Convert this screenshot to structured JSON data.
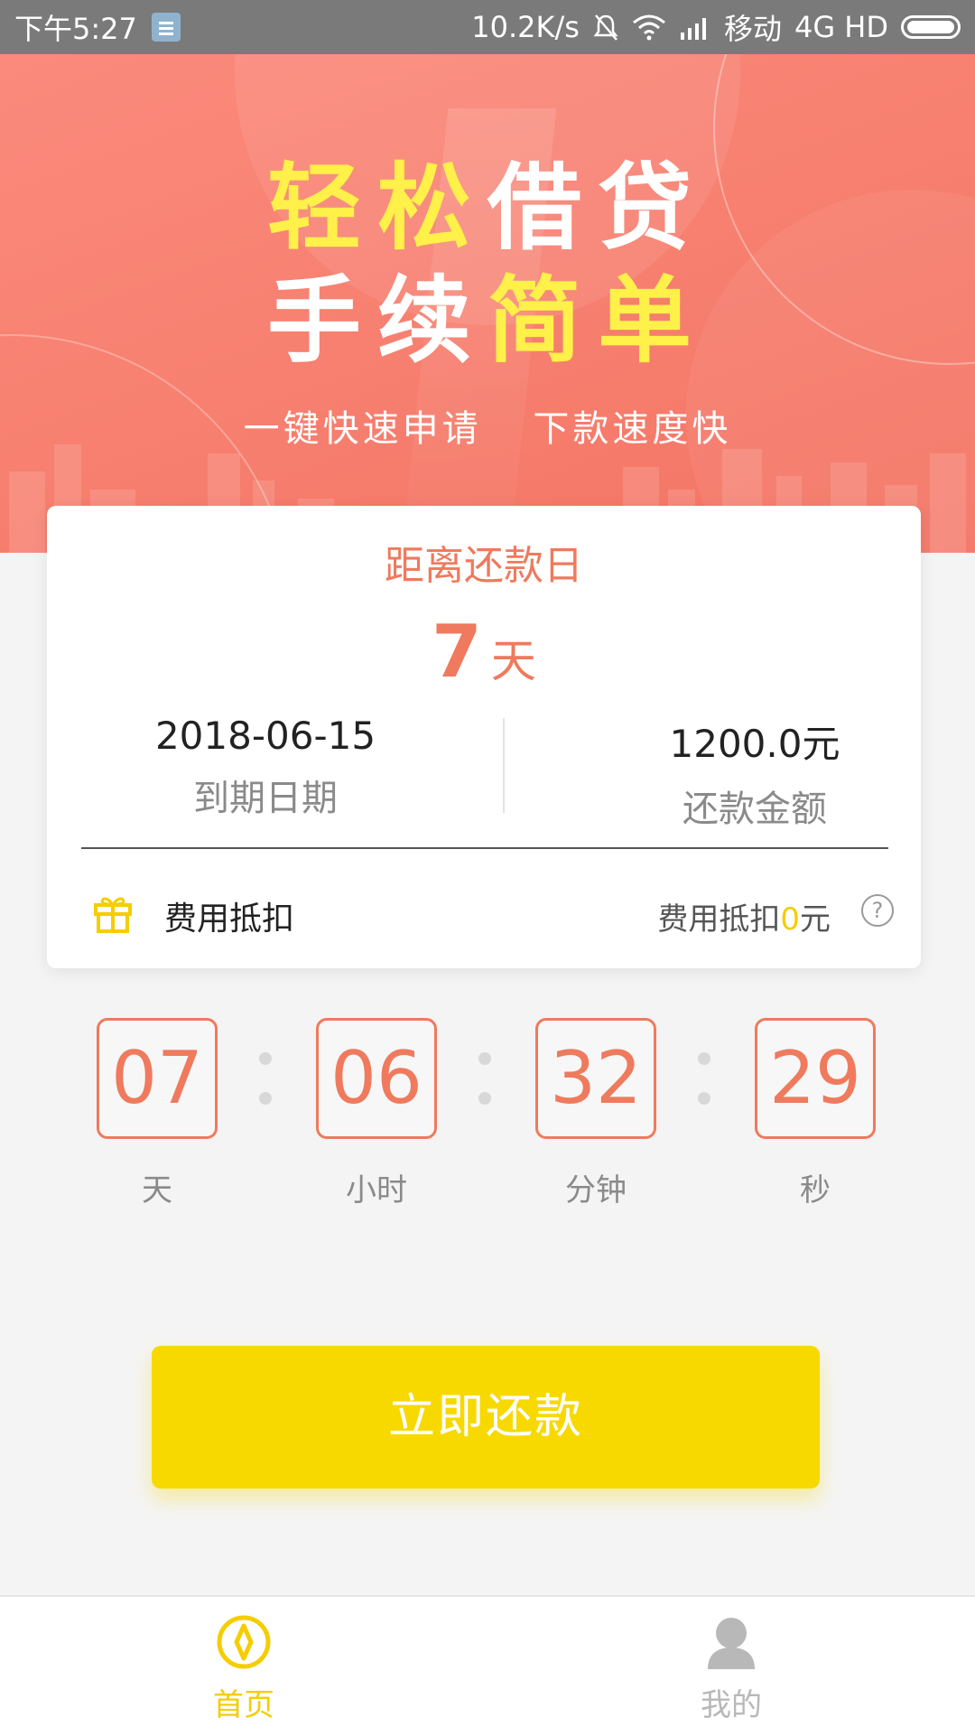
{
  "status_bar": {
    "time": "下午5:27",
    "speed": "10.2K/s",
    "carrier": "移动",
    "network": "4G HD"
  },
  "banner": {
    "headline_line1_a": "轻松",
    "headline_line1_b": "借贷",
    "headline_line2_a": "手续",
    "headline_line2_b": "简单",
    "sub_left": "一键快速申请",
    "sub_right": "下款速度快"
  },
  "card": {
    "title": "距离还款日",
    "days_value": "7",
    "days_unit": "天",
    "due_date": "2018-06-15",
    "due_date_label": "到期日期",
    "amount": "1200.0元",
    "amount_label": "还款金额",
    "fee_label": "费用抵扣",
    "fee_prefix": "费用抵扣",
    "fee_value": "0",
    "fee_suffix": "元",
    "help_icon_glyph": "?"
  },
  "countdown": {
    "days": "07",
    "hours": "06",
    "minutes": "32",
    "seconds": "29",
    "days_label": "天",
    "hours_label": "小时",
    "minutes_label": "分钟",
    "seconds_label": "秒"
  },
  "action": {
    "repay_label": "立即还款"
  },
  "tabs": {
    "home": "首页",
    "mine": "我的"
  },
  "colors": {
    "accent_orange": "#ef7a5d",
    "accent_yellow": "#f7d900",
    "banner": "#f78070"
  }
}
